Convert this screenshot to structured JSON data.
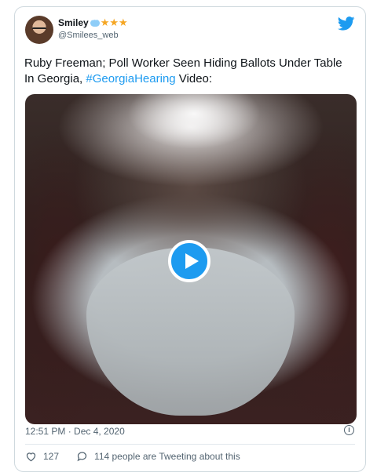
{
  "author": {
    "display_name": "Smiley",
    "handle": "@Smilees_web",
    "badge_icon": "speech-bubble-icon",
    "stars": "★★★"
  },
  "tweet": {
    "text_part1": "Ruby Freeman; Poll Worker Seen Hiding Ballots Under Table In Georgia, ",
    "hashtag": "#GeorgiaHearing",
    "text_part2": " Video:",
    "timestamp": "12:51 PM · Dec 4, 2020"
  },
  "actions": {
    "likes": "127",
    "conversation": "114 people are Tweeting about this"
  },
  "icons": {
    "brand": "twitter-bird-icon",
    "play": "play-icon",
    "info": "info-icon",
    "like": "heart-icon",
    "reply": "reply-icon"
  },
  "colors": {
    "accent": "#1d9bf0",
    "star": "#f5a623",
    "muted": "#536471"
  }
}
